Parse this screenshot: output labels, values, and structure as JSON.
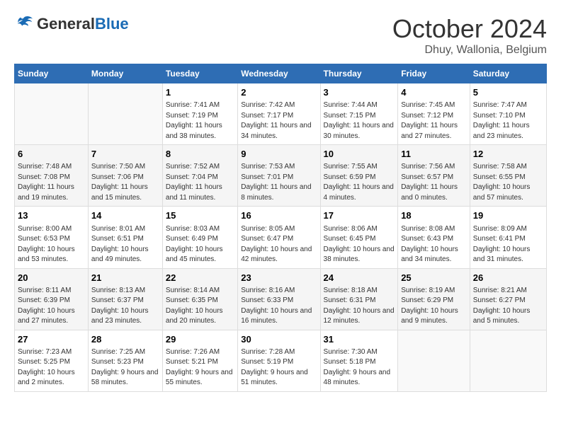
{
  "logo": {
    "general": "General",
    "blue": "Blue"
  },
  "header": {
    "month": "October 2024",
    "location": "Dhuy, Wallonia, Belgium"
  },
  "columns": [
    "Sunday",
    "Monday",
    "Tuesday",
    "Wednesday",
    "Thursday",
    "Friday",
    "Saturday"
  ],
  "weeks": [
    [
      {
        "day": "",
        "info": ""
      },
      {
        "day": "",
        "info": ""
      },
      {
        "day": "1",
        "info": "Sunrise: 7:41 AM\nSunset: 7:19 PM\nDaylight: 11 hours and 38 minutes."
      },
      {
        "day": "2",
        "info": "Sunrise: 7:42 AM\nSunset: 7:17 PM\nDaylight: 11 hours and 34 minutes."
      },
      {
        "day": "3",
        "info": "Sunrise: 7:44 AM\nSunset: 7:15 PM\nDaylight: 11 hours and 30 minutes."
      },
      {
        "day": "4",
        "info": "Sunrise: 7:45 AM\nSunset: 7:12 PM\nDaylight: 11 hours and 27 minutes."
      },
      {
        "day": "5",
        "info": "Sunrise: 7:47 AM\nSunset: 7:10 PM\nDaylight: 11 hours and 23 minutes."
      }
    ],
    [
      {
        "day": "6",
        "info": "Sunrise: 7:48 AM\nSunset: 7:08 PM\nDaylight: 11 hours and 19 minutes."
      },
      {
        "day": "7",
        "info": "Sunrise: 7:50 AM\nSunset: 7:06 PM\nDaylight: 11 hours and 15 minutes."
      },
      {
        "day": "8",
        "info": "Sunrise: 7:52 AM\nSunset: 7:04 PM\nDaylight: 11 hours and 11 minutes."
      },
      {
        "day": "9",
        "info": "Sunrise: 7:53 AM\nSunset: 7:01 PM\nDaylight: 11 hours and 8 minutes."
      },
      {
        "day": "10",
        "info": "Sunrise: 7:55 AM\nSunset: 6:59 PM\nDaylight: 11 hours and 4 minutes."
      },
      {
        "day": "11",
        "info": "Sunrise: 7:56 AM\nSunset: 6:57 PM\nDaylight: 11 hours and 0 minutes."
      },
      {
        "day": "12",
        "info": "Sunrise: 7:58 AM\nSunset: 6:55 PM\nDaylight: 10 hours and 57 minutes."
      }
    ],
    [
      {
        "day": "13",
        "info": "Sunrise: 8:00 AM\nSunset: 6:53 PM\nDaylight: 10 hours and 53 minutes."
      },
      {
        "day": "14",
        "info": "Sunrise: 8:01 AM\nSunset: 6:51 PM\nDaylight: 10 hours and 49 minutes."
      },
      {
        "day": "15",
        "info": "Sunrise: 8:03 AM\nSunset: 6:49 PM\nDaylight: 10 hours and 45 minutes."
      },
      {
        "day": "16",
        "info": "Sunrise: 8:05 AM\nSunset: 6:47 PM\nDaylight: 10 hours and 42 minutes."
      },
      {
        "day": "17",
        "info": "Sunrise: 8:06 AM\nSunset: 6:45 PM\nDaylight: 10 hours and 38 minutes."
      },
      {
        "day": "18",
        "info": "Sunrise: 8:08 AM\nSunset: 6:43 PM\nDaylight: 10 hours and 34 minutes."
      },
      {
        "day": "19",
        "info": "Sunrise: 8:09 AM\nSunset: 6:41 PM\nDaylight: 10 hours and 31 minutes."
      }
    ],
    [
      {
        "day": "20",
        "info": "Sunrise: 8:11 AM\nSunset: 6:39 PM\nDaylight: 10 hours and 27 minutes."
      },
      {
        "day": "21",
        "info": "Sunrise: 8:13 AM\nSunset: 6:37 PM\nDaylight: 10 hours and 23 minutes."
      },
      {
        "day": "22",
        "info": "Sunrise: 8:14 AM\nSunset: 6:35 PM\nDaylight: 10 hours and 20 minutes."
      },
      {
        "day": "23",
        "info": "Sunrise: 8:16 AM\nSunset: 6:33 PM\nDaylight: 10 hours and 16 minutes."
      },
      {
        "day": "24",
        "info": "Sunrise: 8:18 AM\nSunset: 6:31 PM\nDaylight: 10 hours and 12 minutes."
      },
      {
        "day": "25",
        "info": "Sunrise: 8:19 AM\nSunset: 6:29 PM\nDaylight: 10 hours and 9 minutes."
      },
      {
        "day": "26",
        "info": "Sunrise: 8:21 AM\nSunset: 6:27 PM\nDaylight: 10 hours and 5 minutes."
      }
    ],
    [
      {
        "day": "27",
        "info": "Sunrise: 7:23 AM\nSunset: 5:25 PM\nDaylight: 10 hours and 2 minutes."
      },
      {
        "day": "28",
        "info": "Sunrise: 7:25 AM\nSunset: 5:23 PM\nDaylight: 9 hours and 58 minutes."
      },
      {
        "day": "29",
        "info": "Sunrise: 7:26 AM\nSunset: 5:21 PM\nDaylight: 9 hours and 55 minutes."
      },
      {
        "day": "30",
        "info": "Sunrise: 7:28 AM\nSunset: 5:19 PM\nDaylight: 9 hours and 51 minutes."
      },
      {
        "day": "31",
        "info": "Sunrise: 7:30 AM\nSunset: 5:18 PM\nDaylight: 9 hours and 48 minutes."
      },
      {
        "day": "",
        "info": ""
      },
      {
        "day": "",
        "info": ""
      }
    ]
  ]
}
